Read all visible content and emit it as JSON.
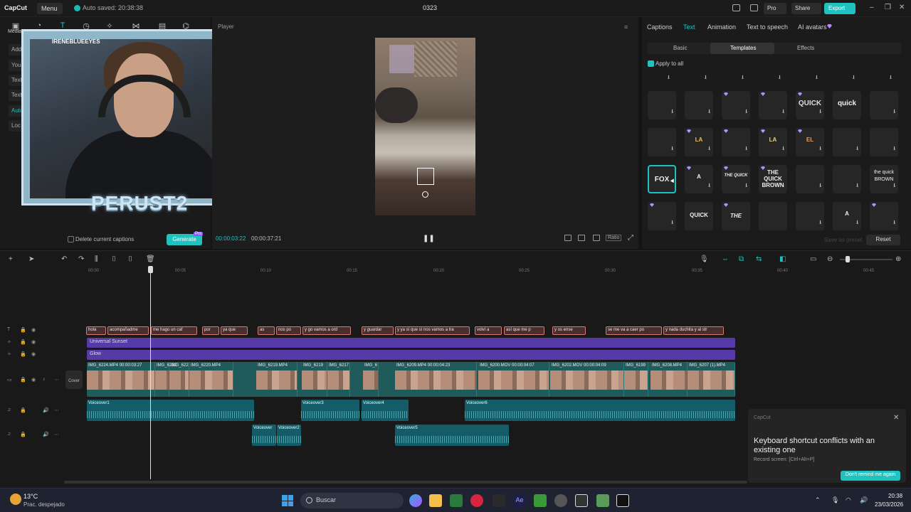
{
  "titlebar": {
    "app_name": "CapCut",
    "menu_label": "Menu",
    "autosave": "Auto saved: 20:38:38",
    "project_name": "0323",
    "pro_label": "Pro",
    "share_label": "Share",
    "export_label": "Export"
  },
  "media_panel": {
    "tab_media": "Media",
    "side_items": [
      "Add",
      "You",
      "Text",
      "Text",
      "Auto",
      "Loc"
    ],
    "webcam_handle": "IRENEBLUEEYES",
    "webcam_title": "PERUST2",
    "delete_captions": "Delete current captions",
    "generate": "Generate",
    "generate_badge": "Pro"
  },
  "player": {
    "label": "Player",
    "current_time": "00:00:03:22",
    "total_time": "00:00:37:21",
    "ratio": "Ratio"
  },
  "right_panel": {
    "tabs": [
      "Captions",
      "Text",
      "Animation",
      "Text to speech",
      "AI avatars"
    ],
    "active_tab": "Text",
    "segments": [
      "Basic",
      "Templates",
      "Effects"
    ],
    "apply_all": "Apply to all",
    "templates_row2": [
      "",
      "",
      "",
      "",
      "QUICK",
      "quick",
      ""
    ],
    "templates_row3": [
      "",
      "LA",
      "",
      "LA",
      "EL",
      "",
      ""
    ],
    "templates_row4": [
      "FOX",
      "A",
      "THE QUICK",
      "THE QUICK BROWN",
      "",
      "",
      "the quick BROWN"
    ],
    "templates_row5": [
      "",
      "QUICK",
      "THE",
      "",
      "",
      "A",
      ""
    ],
    "save_preset": "Save as preset",
    "reset": "Reset"
  },
  "timeline": {
    "ruler": [
      "00:00",
      "00:05",
      "00:10",
      "00:15",
      "00:20",
      "00:25",
      "00:30",
      "00:35",
      "00:40",
      "00:45"
    ],
    "captions": [
      "hola",
      "acompañadme",
      "me hago un caf",
      "por",
      "ya que",
      "as",
      "nos po",
      "y go vamos a ord",
      "y guardar",
      "y ya sí que sí nos vamos a tra",
      "volví a",
      "así que me p",
      "y os ense",
      "se me va a caer po",
      "y nada duchita y al str"
    ],
    "fx_tracks": [
      "Universal Sunset",
      "Glow"
    ],
    "cover": "Cover",
    "video_clips": [
      "IMG_6224.MP4  00:00:03:27",
      "IMG_6222",
      "IMG_622",
      "IMG_6220.MP4",
      "IMG_6219.MP4",
      "IMG_6219",
      "IMG_6217",
      "IMG_6",
      "IMG_6209.MP4  00:00:04:23",
      "IMG_6200.MOV  00:00:04:07",
      "IMG_6202.MOV  00:00:04:09",
      "IMG_6199",
      "IMG_6208.MP4",
      "IMG_6207 (1).MP4"
    ],
    "audio_row1": [
      "Voiceover1",
      "Voiceover3",
      "Voiceover4",
      "Voiceover6"
    ],
    "audio_row2": [
      "Voiceover",
      "Voiceover2",
      "Voiceover5"
    ]
  },
  "toast": {
    "app": "CapCut",
    "title": "Keyboard shortcut conflicts with an existing one",
    "subtitle": "Record screen: [Ctrl+Alt+P]",
    "button": "Don't remind me again"
  },
  "taskbar": {
    "temp": "13°C",
    "weather": "Prac. despejado",
    "search": "Buscar",
    "time": "20:38",
    "date": "23/03/2026"
  }
}
